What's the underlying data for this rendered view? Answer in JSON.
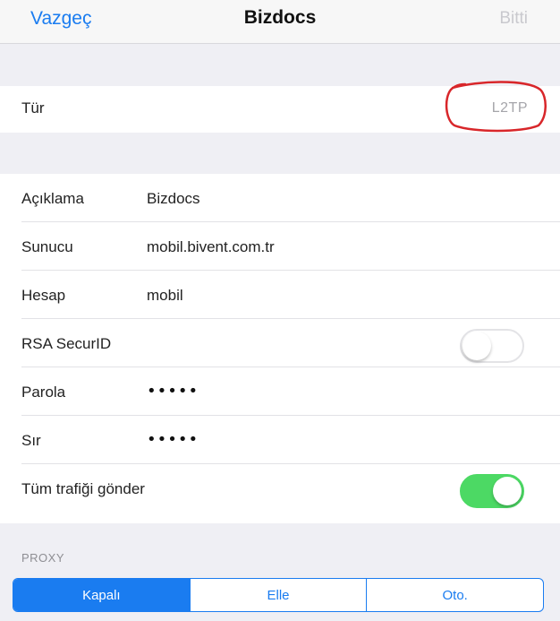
{
  "nav": {
    "cancel": "Vazgeç",
    "title": "Bizdocs",
    "done": "Bitti"
  },
  "type_row": {
    "label": "Tür",
    "value": "L2TP"
  },
  "fields": {
    "description": {
      "label": "Açıklama",
      "value": "Bizdocs"
    },
    "server": {
      "label": "Sunucu",
      "value": "mobil.bivent.com.tr"
    },
    "account": {
      "label": "Hesap",
      "value": "mobil"
    },
    "rsa": {
      "label": "RSA SecurID",
      "enabled": false
    },
    "password": {
      "label": "Parola",
      "value": "•••••"
    },
    "secret": {
      "label": "Sır",
      "value": "•••••"
    },
    "send_all": {
      "label": "Tüm trafiği gönder",
      "enabled": true
    }
  },
  "proxy": {
    "header": "PROXY",
    "options": [
      "Kapalı",
      "Elle",
      "Oto."
    ],
    "selected": "Kapalı"
  },
  "colors": {
    "accent": "#1a7cf0",
    "toggle_on": "#4cd964",
    "annotation": "#d8262a"
  }
}
